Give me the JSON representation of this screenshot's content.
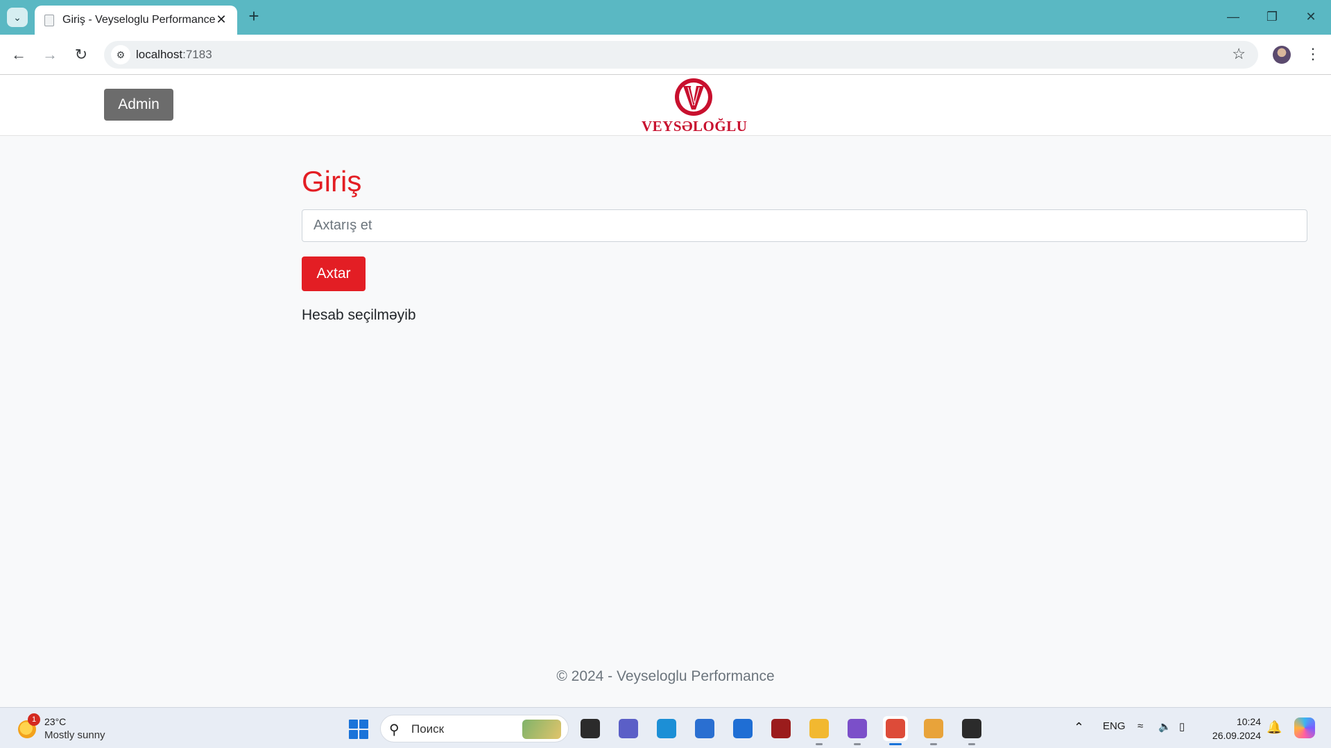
{
  "browser": {
    "tab_title": "Giriş - Veyseloglu Performance",
    "url_host": "localhost",
    "url_port": ":7183"
  },
  "header": {
    "admin_label": "Admin",
    "logo_text": "VEYSƏLOĞLU",
    "brand_color": "#e31e24"
  },
  "main": {
    "title": "Giriş",
    "search_placeholder": "Axtarış et",
    "search_button": "Axtar",
    "status": "Hesab seçilməyib"
  },
  "footer": {
    "text": "© 2024 - Veyseloglu Performance"
  },
  "taskbar": {
    "weather_badge": "1",
    "temperature": "23°C",
    "condition": "Mostly sunny",
    "search_placeholder": "Поиск",
    "language": "ENG",
    "time": "10:24",
    "date": "26.09.2024",
    "apps": [
      {
        "icon": "task-view-icon",
        "color": "#2b2b2b"
      },
      {
        "icon": "teams-icon",
        "color": "#5b5fc7"
      },
      {
        "icon": "edge-icon",
        "color": "#1c8fd6"
      },
      {
        "icon": "store-icon",
        "color": "#2a6fd1"
      },
      {
        "icon": "mail-icon",
        "color": "#1f6ed4"
      },
      {
        "icon": "dbeaver-icon",
        "color": "#9b1c1c"
      },
      {
        "icon": "file-explorer-icon",
        "color": "#f2b830"
      },
      {
        "icon": "visual-studio-icon",
        "color": "#7b4fc9"
      },
      {
        "icon": "chrome-icon",
        "color": "#dd4b39"
      },
      {
        "icon": "tools-icon",
        "color": "#e8a33a"
      },
      {
        "icon": "terminal-icon",
        "color": "#2b2b2b"
      }
    ]
  }
}
